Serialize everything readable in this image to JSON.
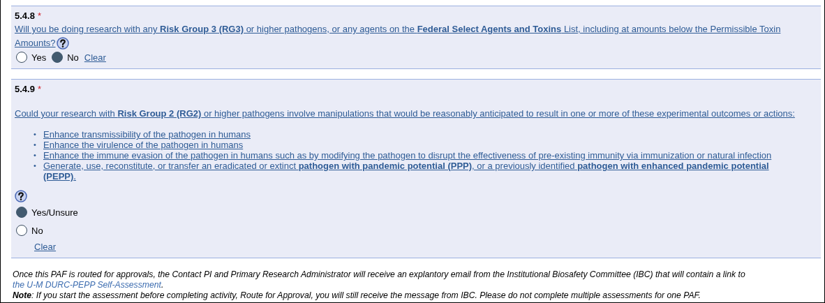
{
  "questions": [
    {
      "number": "5.4.8",
      "required_mark": "*",
      "kind": "inline",
      "text": "Will you be doing research with any **Risk Group 3 (RG3)** or higher pathogens, or any agents on the **Federal Select Agents and Toxins** List, including at amounts below the Permissible Toxin Amounts?",
      "options": [
        {
          "label": "Yes",
          "selected": false
        },
        {
          "label": "No",
          "selected": true
        }
      ],
      "clear": "Clear"
    },
    {
      "number": "5.4.9",
      "required_mark": "*",
      "kind": "stacked",
      "text": "Could your research with **Risk Group 2 (RG2)** or higher pathogens involve manipulations that would be reasonably anticipated to result in one or more of these experimental outcomes or actions:",
      "bullets": [
        {
          "marker": "•",
          "text": "Enhance transmissibility of the pathogen in humans"
        },
        {
          "marker": "•",
          "text": "Enhance the virulence of the pathogen in humans"
        },
        {
          "marker": "•",
          "text": "Enhance the immune evasion of the pathogen in humans such as by modifying the pathogen to disrupt the effectiveness of pre-existing immunity via immunization or natural infection"
        },
        {
          "marker": "•",
          "text": "Generate, use, reconstitute, or transfer an eradicated or extinct **pathogen with pandemic potential (PPP)**, or a previously identified **pathogen with enhanced pandemic potential (PEPP)**."
        }
      ],
      "options": [
        {
          "label": "Yes/Unsure",
          "selected": true
        },
        {
          "label": "No",
          "selected": false
        }
      ],
      "clear": "Clear"
    }
  ],
  "notice": {
    "text": "Once this PAF is routed for approvals, the Contact PI and Primary Research Administrator will receive an explantory email from the Institutional Biosafety Committee (IBC) that will contain a link to",
    "link": "the U-M DURC-PEPP Self-Assessment",
    "after": "."
  },
  "note": "**Note**: If you start the assessment before completing activity, Route for Approval, you will still receive the message from IBC. Please do not complete multiple assessments for one PAF."
}
